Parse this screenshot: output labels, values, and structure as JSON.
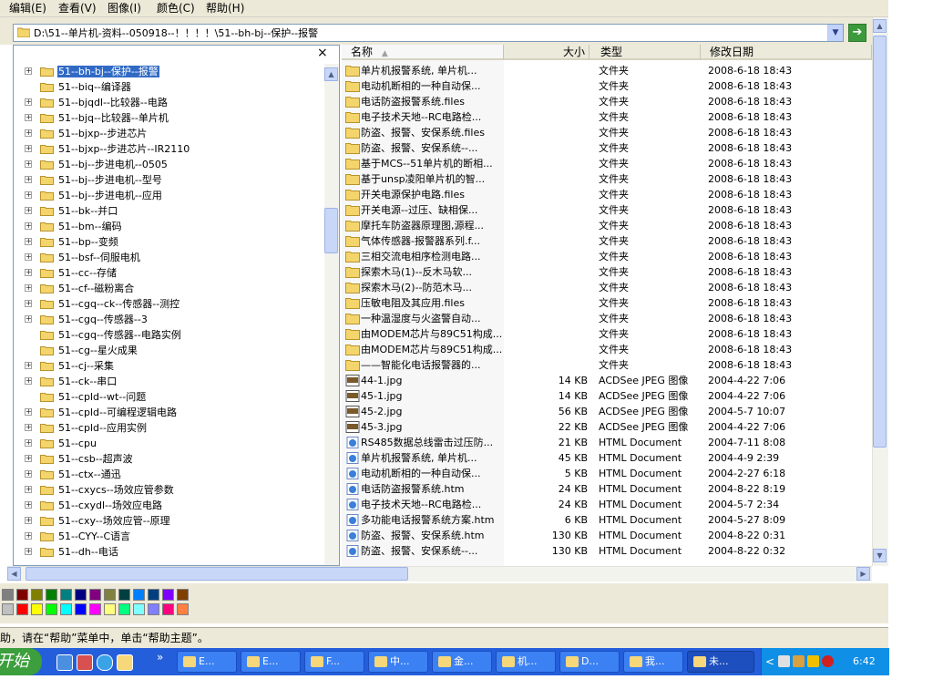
{
  "menu": [
    {
      "label": "编辑(E)"
    },
    {
      "label": "查看(V)"
    },
    {
      "label": "图像(I)"
    },
    {
      "label": "颜色(C)"
    },
    {
      "label": "帮助(H)"
    }
  ],
  "address": {
    "path": "D:\\51--单片机-资料--050918--！！！！\\51--bh-bj--保护--报警",
    "dropdown_icon": "chevron-down-icon",
    "go_icon": "arrow-right-icon"
  },
  "folders_pane": {
    "close_label": "×",
    "items": [
      {
        "label": "51--bh-bj--保护--报警",
        "expander": "+",
        "selected": true
      },
      {
        "label": "51--biq--编译器",
        "expander": ""
      },
      {
        "label": "51--bjqdl--比较器--电路",
        "expander": "+"
      },
      {
        "label": "51--bjq--比较器--单片机",
        "expander": "+"
      },
      {
        "label": "51--bjxp--步进芯片",
        "expander": "+"
      },
      {
        "label": "51--bjxp--步进芯片--IR2110",
        "expander": "+"
      },
      {
        "label": "51--bj--步进电机--0505",
        "expander": "+"
      },
      {
        "label": "51--bj--步进电机--型号",
        "expander": "+"
      },
      {
        "label": "51--bj--步进电机--应用",
        "expander": "+"
      },
      {
        "label": "51--bk--并口",
        "expander": "+"
      },
      {
        "label": "51--bm--编码",
        "expander": "+"
      },
      {
        "label": "51--bp--变频",
        "expander": "+"
      },
      {
        "label": "51--bsf--伺服电机",
        "expander": "+"
      },
      {
        "label": "51--cc--存储",
        "expander": "+"
      },
      {
        "label": "51--cf--磁粉离合",
        "expander": "+"
      },
      {
        "label": "51--cgq--ck--传感器--测控",
        "expander": "+"
      },
      {
        "label": "51--cgq--传感器--3",
        "expander": "+"
      },
      {
        "label": "51--cgq--传感器--电路实例",
        "expander": ""
      },
      {
        "label": "51--cg--星火成果",
        "expander": ""
      },
      {
        "label": "51--cj--采集",
        "expander": "+"
      },
      {
        "label": "51--ck--串口",
        "expander": "+"
      },
      {
        "label": "51--cpld--wt--问题",
        "expander": ""
      },
      {
        "label": "51--cpld--可编程逻辑电路",
        "expander": "+"
      },
      {
        "label": "51--cpld--应用实例",
        "expander": "+"
      },
      {
        "label": "51--cpu",
        "expander": "+"
      },
      {
        "label": "51--csb--超声波",
        "expander": "+"
      },
      {
        "label": "51--ctx--通迅",
        "expander": "+"
      },
      {
        "label": "51--cxycs--场效应管参数",
        "expander": "+"
      },
      {
        "label": "51--cxydl--场效应电路",
        "expander": "+"
      },
      {
        "label": "51--cxy--场效应管--原理",
        "expander": "+"
      },
      {
        "label": "51--CYY--C语言",
        "expander": "+"
      },
      {
        "label": "51--dh--电话",
        "expander": "+"
      }
    ]
  },
  "columns": {
    "name": "名称",
    "sort_indicator": "▲",
    "size": "大小",
    "type": "类型",
    "date": "修改日期"
  },
  "files": [
    {
      "name": "单片机报警系统, 单片机...",
      "size": "",
      "type": "文件夹",
      "date": "2008-6-18 18:43",
      "icon": "folder-icon"
    },
    {
      "name": "电动机断相的一种自动保...",
      "size": "",
      "type": "文件夹",
      "date": "2008-6-18 18:43",
      "icon": "folder-icon"
    },
    {
      "name": "电话防盗报警系统.files",
      "size": "",
      "type": "文件夹",
      "date": "2008-6-18 18:43",
      "icon": "folder-icon"
    },
    {
      "name": "电子技术天地--RC电路检...",
      "size": "",
      "type": "文件夹",
      "date": "2008-6-18 18:43",
      "icon": "folder-icon"
    },
    {
      "name": "防盗、报警、安保系统.files",
      "size": "",
      "type": "文件夹",
      "date": "2008-6-18 18:43",
      "icon": "folder-icon"
    },
    {
      "name": "防盗、报警、安保系统--...",
      "size": "",
      "type": "文件夹",
      "date": "2008-6-18 18:43",
      "icon": "folder-icon"
    },
    {
      "name": "基于MCS--51单片机的断相...",
      "size": "",
      "type": "文件夹",
      "date": "2008-6-18 18:43",
      "icon": "folder-icon"
    },
    {
      "name": "基于unsp凌阳单片机的智...",
      "size": "",
      "type": "文件夹",
      "date": "2008-6-18 18:43",
      "icon": "folder-icon"
    },
    {
      "name": "开关电源保护电路.files",
      "size": "",
      "type": "文件夹",
      "date": "2008-6-18 18:43",
      "icon": "folder-icon"
    },
    {
      "name": "开关电源--过压、缺相保...",
      "size": "",
      "type": "文件夹",
      "date": "2008-6-18 18:43",
      "icon": "folder-icon"
    },
    {
      "name": "摩托车防盗器原理图,源程...",
      "size": "",
      "type": "文件夹",
      "date": "2008-6-18 18:43",
      "icon": "folder-icon"
    },
    {
      "name": "气体传感器-报警器系列.f...",
      "size": "",
      "type": "文件夹",
      "date": "2008-6-18 18:43",
      "icon": "folder-icon"
    },
    {
      "name": "三相交流电相序检测电路...",
      "size": "",
      "type": "文件夹",
      "date": "2008-6-18 18:43",
      "icon": "folder-icon"
    },
    {
      "name": "探索木马(1)--反木马软...",
      "size": "",
      "type": "文件夹",
      "date": "2008-6-18 18:43",
      "icon": "folder-icon"
    },
    {
      "name": "探索木马(2)--防范木马...",
      "size": "",
      "type": "文件夹",
      "date": "2008-6-18 18:43",
      "icon": "folder-icon"
    },
    {
      "name": "压敏电阻及其应用.files",
      "size": "",
      "type": "文件夹",
      "date": "2008-6-18 18:43",
      "icon": "folder-icon"
    },
    {
      "name": "一种温湿度与火盗警自动...",
      "size": "",
      "type": "文件夹",
      "date": "2008-6-18 18:43",
      "icon": "folder-icon"
    },
    {
      "name": "由MODEM芯片与89C51构成...",
      "size": "",
      "type": "文件夹",
      "date": "2008-6-18 18:43",
      "icon": "folder-icon"
    },
    {
      "name": "由MODEM芯片与89C51构成...",
      "size": "",
      "type": "文件夹",
      "date": "2008-6-18 18:43",
      "icon": "folder-icon"
    },
    {
      "name": "——智能化电话报警器的...",
      "size": "",
      "type": "文件夹",
      "date": "2008-6-18 18:43",
      "icon": "folder-icon"
    },
    {
      "name": "44-1.jpg",
      "size": "14 KB",
      "type": "ACDSee JPEG 图像",
      "date": "2004-4-22 7:06",
      "icon": "jpeg-icon"
    },
    {
      "name": "45-1.jpg",
      "size": "14 KB",
      "type": "ACDSee JPEG 图像",
      "date": "2004-4-22 7:06",
      "icon": "jpeg-icon"
    },
    {
      "name": "45-2.jpg",
      "size": "56 KB",
      "type": "ACDSee JPEG 图像",
      "date": "2004-5-7 10:07",
      "icon": "jpeg-icon"
    },
    {
      "name": "45-3.jpg",
      "size": "22 KB",
      "type": "ACDSee JPEG 图像",
      "date": "2004-4-22 7:06",
      "icon": "jpeg-icon"
    },
    {
      "name": "RS485数据总线雷击过压防...",
      "size": "21 KB",
      "type": "HTML Document",
      "date": "2004-7-11 8:08",
      "icon": "html-icon"
    },
    {
      "name": "单片机报警系统, 单片机...",
      "size": "45 KB",
      "type": "HTML Document",
      "date": "2004-4-9 2:39",
      "icon": "html-icon"
    },
    {
      "name": "电动机断相的一种自动保...",
      "size": "5 KB",
      "type": "HTML Document",
      "date": "2004-2-27 6:18",
      "icon": "html-icon"
    },
    {
      "name": "电话防盗报警系统.htm",
      "size": "24 KB",
      "type": "HTML Document",
      "date": "2004-8-22 8:19",
      "icon": "html-icon"
    },
    {
      "name": "电子技术天地--RC电路检...",
      "size": "24 KB",
      "type": "HTML Document",
      "date": "2004-5-7 2:34",
      "icon": "html-icon"
    },
    {
      "name": "多功能电话报警系统方案.htm",
      "size": "6 KB",
      "type": "HTML Document",
      "date": "2004-5-27 8:09",
      "icon": "html-icon"
    },
    {
      "name": "防盗、报警、安保系统.htm",
      "size": "130 KB",
      "type": "HTML Document",
      "date": "2004-8-22 0:31",
      "icon": "html-icon"
    },
    {
      "name": "防盗、报警、安保系统--...",
      "size": "130 KB",
      "type": "HTML Document",
      "date": "2004-8-22 0:32",
      "icon": "html-icon"
    }
  ],
  "palette": {
    "row1": [
      "#808080",
      "#800000",
      "#808000",
      "#008000",
      "#008080",
      "#000080",
      "#800080",
      "#808040",
      "#004040",
      "#0080ff",
      "#004080",
      "#8000ff",
      "#804000"
    ],
    "row2": [
      "#c0c0c0",
      "#ff0000",
      "#ffff00",
      "#00ff00",
      "#00ffff",
      "#0000ff",
      "#ff00ff",
      "#ffff80",
      "#00ff80",
      "#80ffff",
      "#8080ff",
      "#ff0080",
      "#ff8040"
    ]
  },
  "status": {
    "text": "助，请在“帮助”菜单中，单击“帮助主题”。"
  },
  "taskbar": {
    "start_label": "开始",
    "overflow": "»",
    "buttons": [
      {
        "label": "E..."
      },
      {
        "label": "E..."
      },
      {
        "label": "F..."
      },
      {
        "label": "中..."
      },
      {
        "label": "金..."
      },
      {
        "label": "机..."
      },
      {
        "label": "D..."
      },
      {
        "label": "我..."
      },
      {
        "label": "未..."
      }
    ],
    "tray_chevron": "<",
    "clock": "6:42"
  }
}
